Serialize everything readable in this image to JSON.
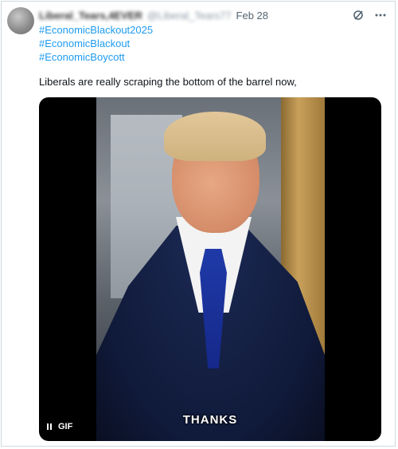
{
  "tweet": {
    "author_name": "Liberal_Tears,4EVER",
    "author_handle": "@Liberal_Tears77",
    "date": "Feb 28",
    "hashtags": [
      "#EconomicBlackout2025",
      "#EconomicBlackout",
      "#EconomicBoycott"
    ],
    "text": "Liberals are really scraping the bottom of the barrel now,"
  },
  "media": {
    "caption": "THANKS",
    "badge": "GIF"
  },
  "icons": {
    "grok": "grok-icon",
    "more": "more-icon",
    "pause": "pause-icon"
  }
}
